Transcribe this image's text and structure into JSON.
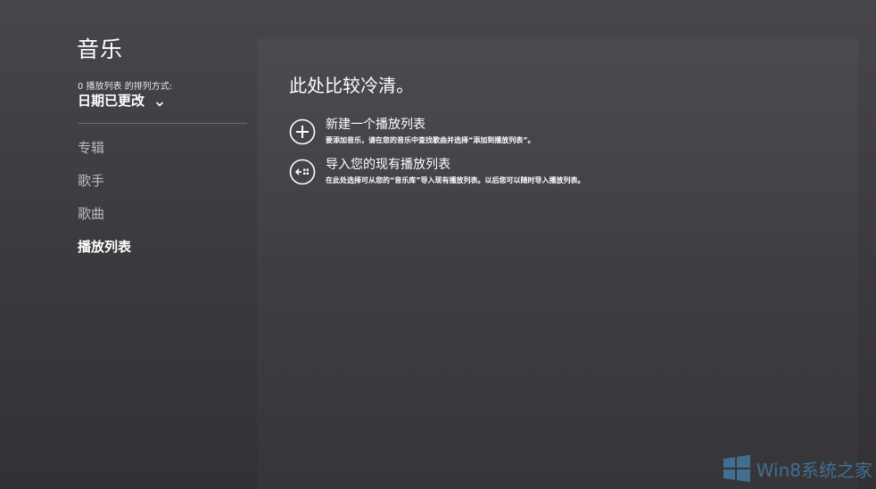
{
  "app": {
    "title": "音乐"
  },
  "sort": {
    "caption": "0 播放列表 的排列方式:",
    "value": "日期已更改"
  },
  "nav": {
    "items": [
      {
        "label": "专辑",
        "active": false
      },
      {
        "label": "歌手",
        "active": false
      },
      {
        "label": "歌曲",
        "active": false
      },
      {
        "label": "播放列表",
        "active": true
      }
    ]
  },
  "main": {
    "heading": "此处比较冷清。",
    "actions": [
      {
        "icon": "plus-circle-icon",
        "title": "新建一个播放列表",
        "description": "要添加音乐，请在您的音乐中查找歌曲并选择“添加到播放列表”。"
      },
      {
        "icon": "import-circle-icon",
        "title": "导入您的现有播放列表",
        "description": "在此处选择可从您的“音乐库”导入现有播放列表。以后您可以随时导入播放列表。"
      }
    ]
  },
  "watermark": {
    "text": "Win8系统之家",
    "logo": "windows-logo-icon"
  },
  "colors": {
    "background": "#3f3e42",
    "text": "#ffffff",
    "nav_inactive": "#bcbbc0",
    "watermark": "#4c9fd6"
  }
}
